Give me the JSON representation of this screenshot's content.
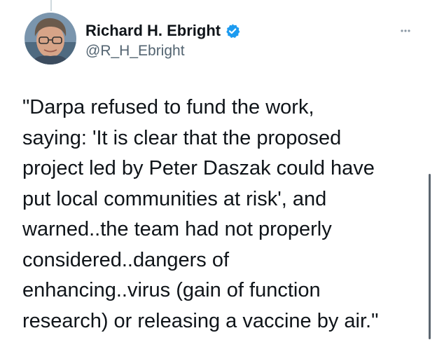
{
  "tweet": {
    "author": {
      "display_name": "Richard H. Ebright",
      "handle": "@R_H_Ebright",
      "verified": true,
      "avatar_icon": "user-avatar-photo",
      "verified_icon": "verified-badge-icon"
    },
    "more_icon": "more-options-icon",
    "text": "\"Darpa refused to fund the work,\nsaying: 'It is clear that the proposed\nproject led by Peter Daszak could have\nput local communities at risk', and\nwarned..the team had not properly\nconsidered..dangers of\nenhancing..virus (gain of function\nresearch) or releasing a vaccine by air.\""
  },
  "colors": {
    "text_primary": "#0f1419",
    "text_secondary": "#536471",
    "verified_blue": "#1d9bf0",
    "thread_line": "#cfd9de",
    "scrollbar": "#5c6670"
  }
}
